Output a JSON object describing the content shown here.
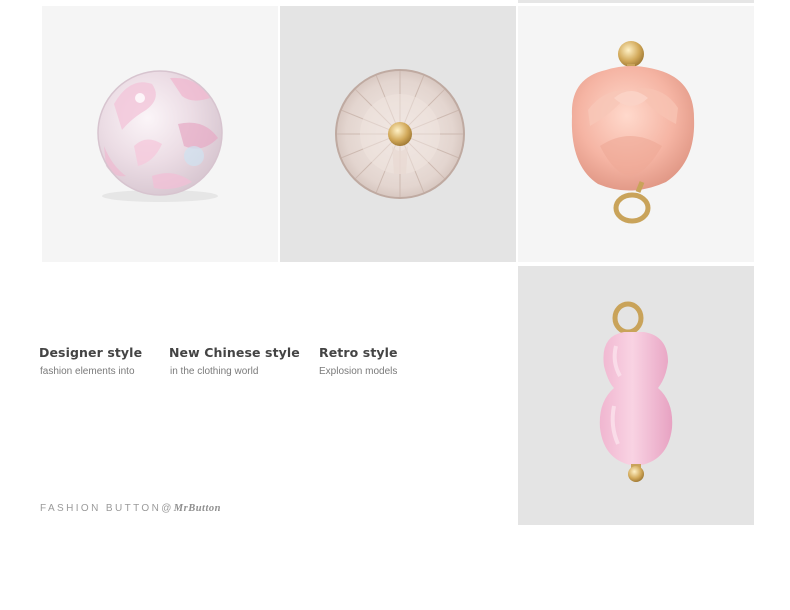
{
  "products": [
    {
      "name": "pink-glitter-sphere-bead"
    },
    {
      "name": "faceted-crystal-button"
    },
    {
      "name": "pink-rose-bud-pendant"
    },
    {
      "name": "pink-gourd-pendant"
    }
  ],
  "features": [
    {
      "title": "Designer style",
      "subtitle": "fashion elements into"
    },
    {
      "title": "New Chinese style",
      "subtitle": "in the clothing world"
    },
    {
      "title": "Retro style",
      "subtitle": "Explosion models"
    }
  ],
  "tagline": {
    "text": "FASHION  BUTTON@",
    "brand": "MrButton"
  },
  "colors": {
    "text_dark": "#444444",
    "text_muted": "#7a7a7a",
    "tile_light": "#f5f5f5",
    "tile_gray": "#e4e4e4",
    "gold": "#c9a35a",
    "pink": "#f2b3a6"
  }
}
